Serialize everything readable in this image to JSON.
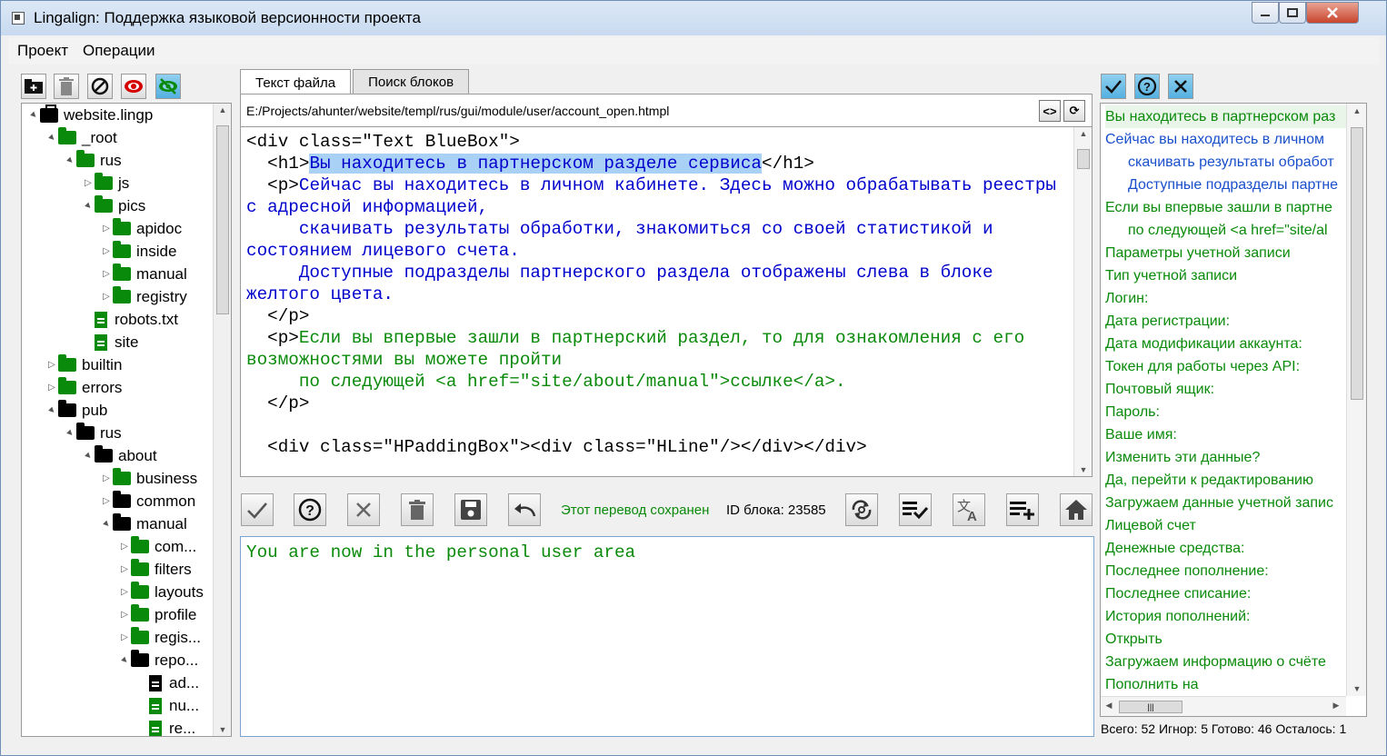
{
  "window": {
    "title": "Lingalign: Поддержка языковой версионности проекта"
  },
  "menu": [
    "Проект",
    "Операции"
  ],
  "left_toolbar": [
    {
      "icon": "add-folder-icon"
    },
    {
      "icon": "trash-icon"
    },
    {
      "icon": "block-icon"
    },
    {
      "icon": "eye-icon"
    },
    {
      "icon": "eye-off-icon"
    }
  ],
  "tree": [
    {
      "label": "website.lingp",
      "depth": 0,
      "kind": "project",
      "arrow": "▲"
    },
    {
      "label": "_root",
      "depth": 1,
      "kind": "folder-green",
      "arrow": "▲"
    },
    {
      "label": "rus",
      "depth": 2,
      "kind": "folder-green",
      "arrow": "▲"
    },
    {
      "label": "js",
      "depth": 3,
      "kind": "folder-green",
      "arrow": "▷"
    },
    {
      "label": "pics",
      "depth": 3,
      "kind": "folder-green",
      "arrow": "▲"
    },
    {
      "label": "apidoc",
      "depth": 4,
      "kind": "folder-green",
      "arrow": "▷"
    },
    {
      "label": "inside",
      "depth": 4,
      "kind": "folder-green",
      "arrow": "▷"
    },
    {
      "label": "manual",
      "depth": 4,
      "kind": "folder-green",
      "arrow": "▷"
    },
    {
      "label": "registry",
      "depth": 4,
      "kind": "folder-green",
      "arrow": "▷"
    },
    {
      "label": "robots.txt",
      "depth": 3,
      "kind": "file-green",
      "arrow": ""
    },
    {
      "label": "site",
      "depth": 3,
      "kind": "file-green",
      "arrow": ""
    },
    {
      "label": "builtin",
      "depth": 1,
      "kind": "folder-green",
      "arrow": "▷"
    },
    {
      "label": "errors",
      "depth": 1,
      "kind": "folder-green",
      "arrow": "▷"
    },
    {
      "label": "pub",
      "depth": 1,
      "kind": "folder-black",
      "arrow": "▲"
    },
    {
      "label": "rus",
      "depth": 2,
      "kind": "folder-black",
      "arrow": "▲"
    },
    {
      "label": "about",
      "depth": 3,
      "kind": "folder-black",
      "arrow": "▲"
    },
    {
      "label": "business",
      "depth": 4,
      "kind": "folder-green",
      "arrow": "▷"
    },
    {
      "label": "common",
      "depth": 4,
      "kind": "folder-black",
      "arrow": "▷"
    },
    {
      "label": "manual",
      "depth": 4,
      "kind": "folder-black",
      "arrow": "▲"
    },
    {
      "label": "com...",
      "depth": 5,
      "kind": "folder-green",
      "arrow": "▷"
    },
    {
      "label": "filters",
      "depth": 5,
      "kind": "folder-green",
      "arrow": "▷"
    },
    {
      "label": "layouts",
      "depth": 5,
      "kind": "folder-green",
      "arrow": "▷"
    },
    {
      "label": "profile",
      "depth": 5,
      "kind": "folder-green",
      "arrow": "▷"
    },
    {
      "label": "regis...",
      "depth": 5,
      "kind": "folder-green",
      "arrow": "▷"
    },
    {
      "label": "repo...",
      "depth": 5,
      "kind": "folder-black",
      "arrow": "▲"
    },
    {
      "label": "ad...",
      "depth": 6,
      "kind": "file-black",
      "arrow": ""
    },
    {
      "label": "nu...",
      "depth": 6,
      "kind": "file-green",
      "arrow": ""
    },
    {
      "label": "re...",
      "depth": 6,
      "kind": "file-green",
      "arrow": ""
    }
  ],
  "tabs": [
    {
      "label": "Текст файла",
      "active": true
    },
    {
      "label": "Поиск блоков",
      "active": false
    }
  ],
  "file_path": "E:/Projects/ahunter/website/templ/rus/gui/module/user/account_open.htmpl",
  "path_buttons": {
    "code": "<>",
    "refresh": "⟳"
  },
  "code": {
    "l1": "<div class=\"Text BlueBox\">",
    "h1_open": "  <h1>",
    "h1_text": "Вы находитесь в партнерском разделе сервиса",
    "h1_close": "</h1>",
    "p_open": "  <p>",
    "p1_text": "Сейчас вы находитесь в личном кабинете. Здесь можно обрабатывать реестры с адресной информацией,\n     скачивать результаты обработки, знакомиться со своей статистикой и состоянием лицевого счета.\n     Доступные подразделы партнерского раздела отображены слева в блоке желтого цвета.",
    "p_close": "\n  </p>\n",
    "p2_text": "Если вы впервые зашли в партнерский раздел, то для ознакомления с его возможностями вы можете пройти\n     по следующей <a href=\"site/about/manual\">ссылке</a>.",
    "tail": "\n  </p>\n\n  <div class=\"HPaddingBox\"><div class=\"HLine\"/></div></div>"
  },
  "actions": {
    "status": "Этот перевод сохранен",
    "block_id": "ID блока: 23585"
  },
  "translation": "You are now in the personal user area",
  "right_toolbar": [
    {
      "icon": "check-icon"
    },
    {
      "icon": "help-icon"
    },
    {
      "icon": "close-icon"
    }
  ],
  "blocks": [
    {
      "text": "Вы находитесь в партнерском раз",
      "color": "green",
      "indent": false,
      "selected": true
    },
    {
      "text": "Сейчас вы находитесь в личном",
      "color": "blue",
      "indent": false
    },
    {
      "text": "скачивать результаты обработ",
      "color": "blue",
      "indent": true
    },
    {
      "text": "Доступные подразделы партне",
      "color": "blue",
      "indent": true
    },
    {
      "text": "Если вы впервые зашли в партне",
      "color": "green",
      "indent": false
    },
    {
      "text": "по следующей <a href=\"site/al",
      "color": "green",
      "indent": true
    },
    {
      "text": "Параметры учетной записи",
      "color": "green",
      "indent": false
    },
    {
      "text": "Тип учетной записи",
      "color": "green",
      "indent": false
    },
    {
      "text": "Логин:",
      "color": "green",
      "indent": false
    },
    {
      "text": "Дата регистрации:",
      "color": "green",
      "indent": false
    },
    {
      "text": "Дата модификации аккаунта:",
      "color": "green",
      "indent": false
    },
    {
      "text": "Токен для работы через API:",
      "color": "green",
      "indent": false
    },
    {
      "text": "Почтовый ящик:",
      "color": "green",
      "indent": false
    },
    {
      "text": "Пароль:",
      "color": "green",
      "indent": false
    },
    {
      "text": "Ваше имя:",
      "color": "green",
      "indent": false
    },
    {
      "text": "Изменить эти данные?",
      "color": "green",
      "indent": false
    },
    {
      "text": "Да, перейти к редактированию",
      "color": "green",
      "indent": false
    },
    {
      "text": "Загружаем данные учетной запис",
      "color": "green",
      "indent": false
    },
    {
      "text": "Лицевой счет",
      "color": "green",
      "indent": false
    },
    {
      "text": "Денежные средства:",
      "color": "green",
      "indent": false
    },
    {
      "text": "Последнее пополнение:",
      "color": "green",
      "indent": false
    },
    {
      "text": "Последнее списание:",
      "color": "green",
      "indent": false
    },
    {
      "text": "История пополнений:",
      "color": "green",
      "indent": false
    },
    {
      "text": "Открыть",
      "color": "green",
      "indent": false
    },
    {
      "text": "Загружаем информацию о счёте",
      "color": "green",
      "indent": false
    },
    {
      "text": "Пополнить на",
      "color": "green",
      "indent": false
    }
  ],
  "stats": "Всего: 52 Игнор: 5 Готово: 46 Осталось: 1",
  "colors": {
    "green": "#0a8a0a",
    "blue": "#1a4fcc",
    "highlight": "#a9d0f5"
  }
}
